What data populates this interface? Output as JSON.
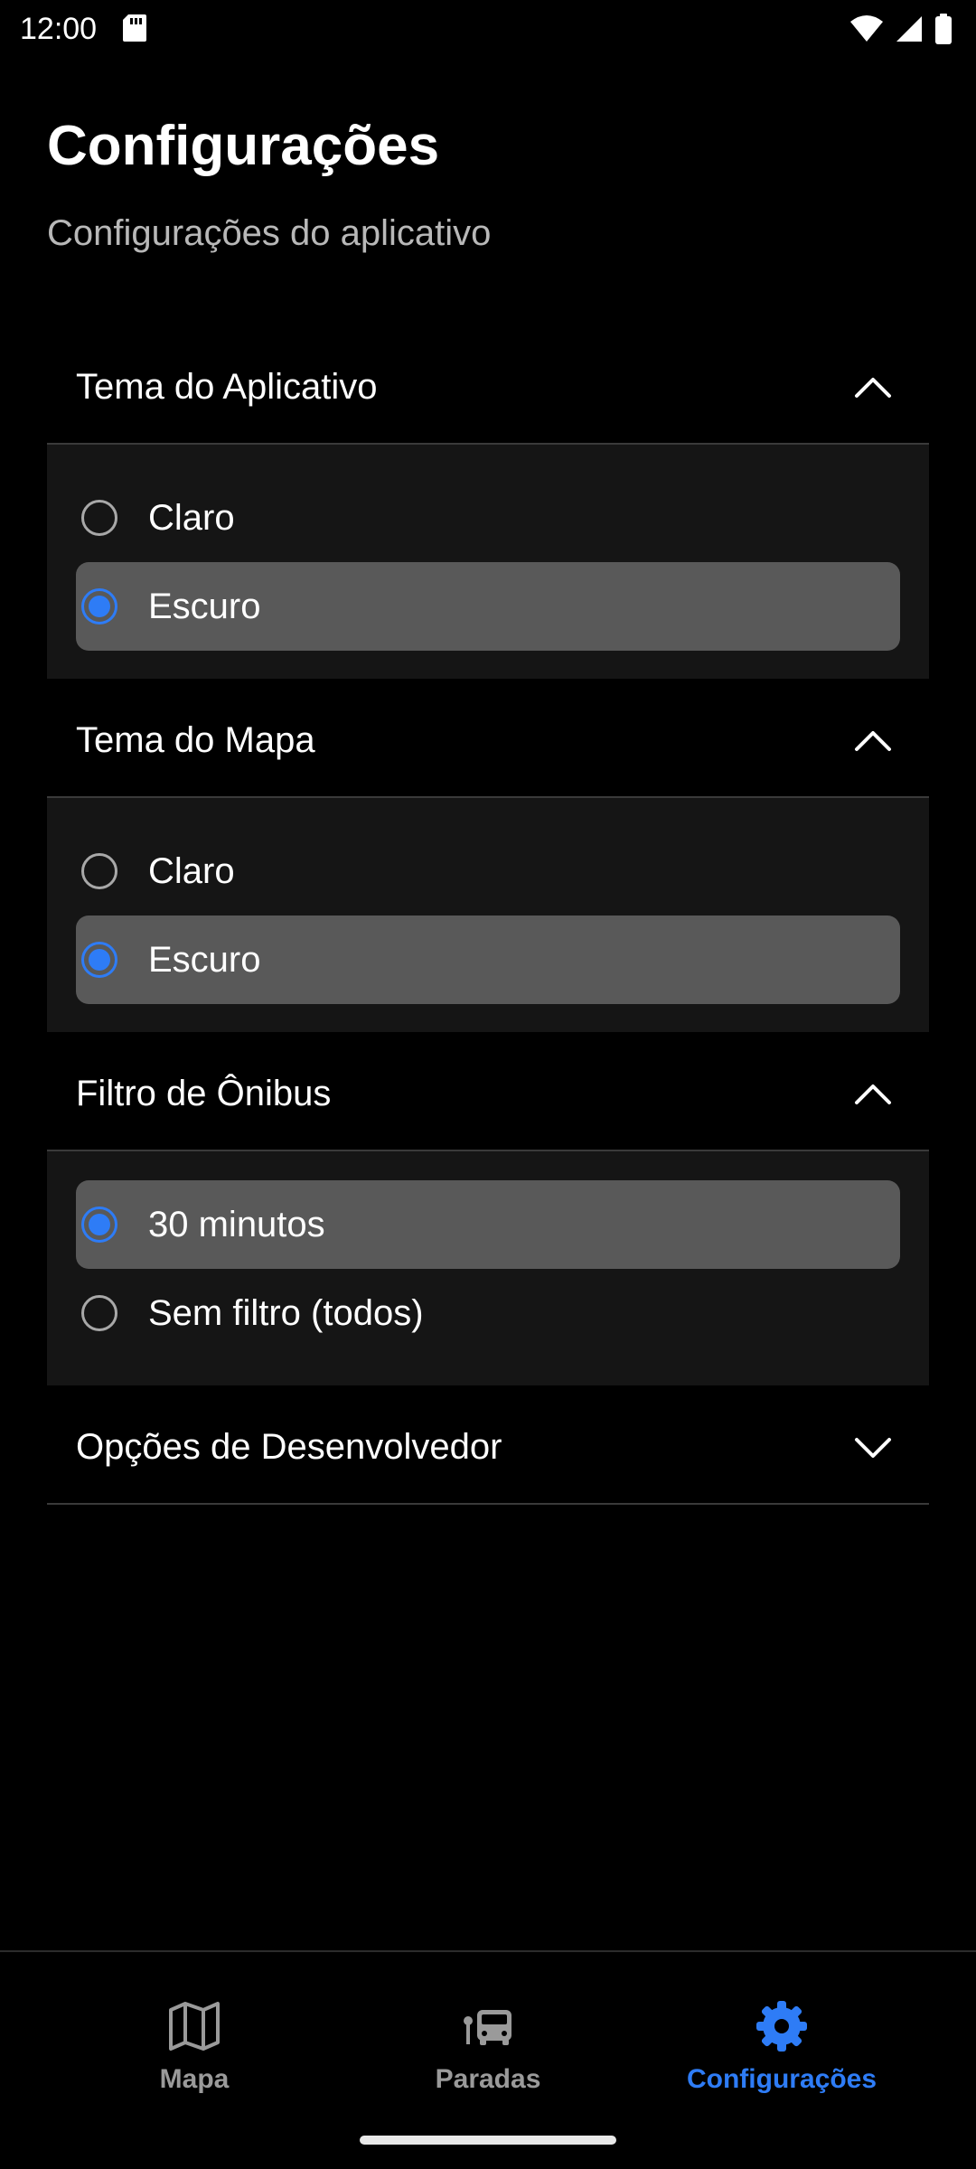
{
  "status_bar": {
    "time": "12:00",
    "icons": [
      "sd-card-icon",
      "wifi-icon",
      "signal-icon",
      "battery-icon"
    ]
  },
  "header": {
    "title": "Configurações",
    "subtitle": "Configurações do aplicativo"
  },
  "sections": [
    {
      "title": "Tema do Aplicativo",
      "expanded": true,
      "options": [
        {
          "label": "Claro",
          "selected": false
        },
        {
          "label": "Escuro",
          "selected": true
        }
      ]
    },
    {
      "title": "Tema do Mapa",
      "expanded": true,
      "options": [
        {
          "label": "Claro",
          "selected": false
        },
        {
          "label": "Escuro",
          "selected": true
        }
      ]
    },
    {
      "title": "Filtro de Ônibus",
      "expanded": true,
      "options": [
        {
          "label": "30 minutos",
          "selected": true
        },
        {
          "label": "Sem filtro (todos)",
          "selected": false
        }
      ]
    },
    {
      "title": "Opções de Desenvolvedor",
      "expanded": false,
      "options": []
    }
  ],
  "bottom_nav": {
    "items": [
      {
        "label": "Mapa",
        "icon": "map-icon",
        "active": false
      },
      {
        "label": "Paradas",
        "icon": "bus-stop-icon",
        "active": false
      },
      {
        "label": "Configurações",
        "icon": "gear-icon",
        "active": true
      }
    ]
  },
  "colors": {
    "background": "#000000",
    "accent": "#2e7cf6",
    "section_body": "#151515",
    "selected_row": "#595959",
    "inactive_nav": "#9a9a9a"
  }
}
